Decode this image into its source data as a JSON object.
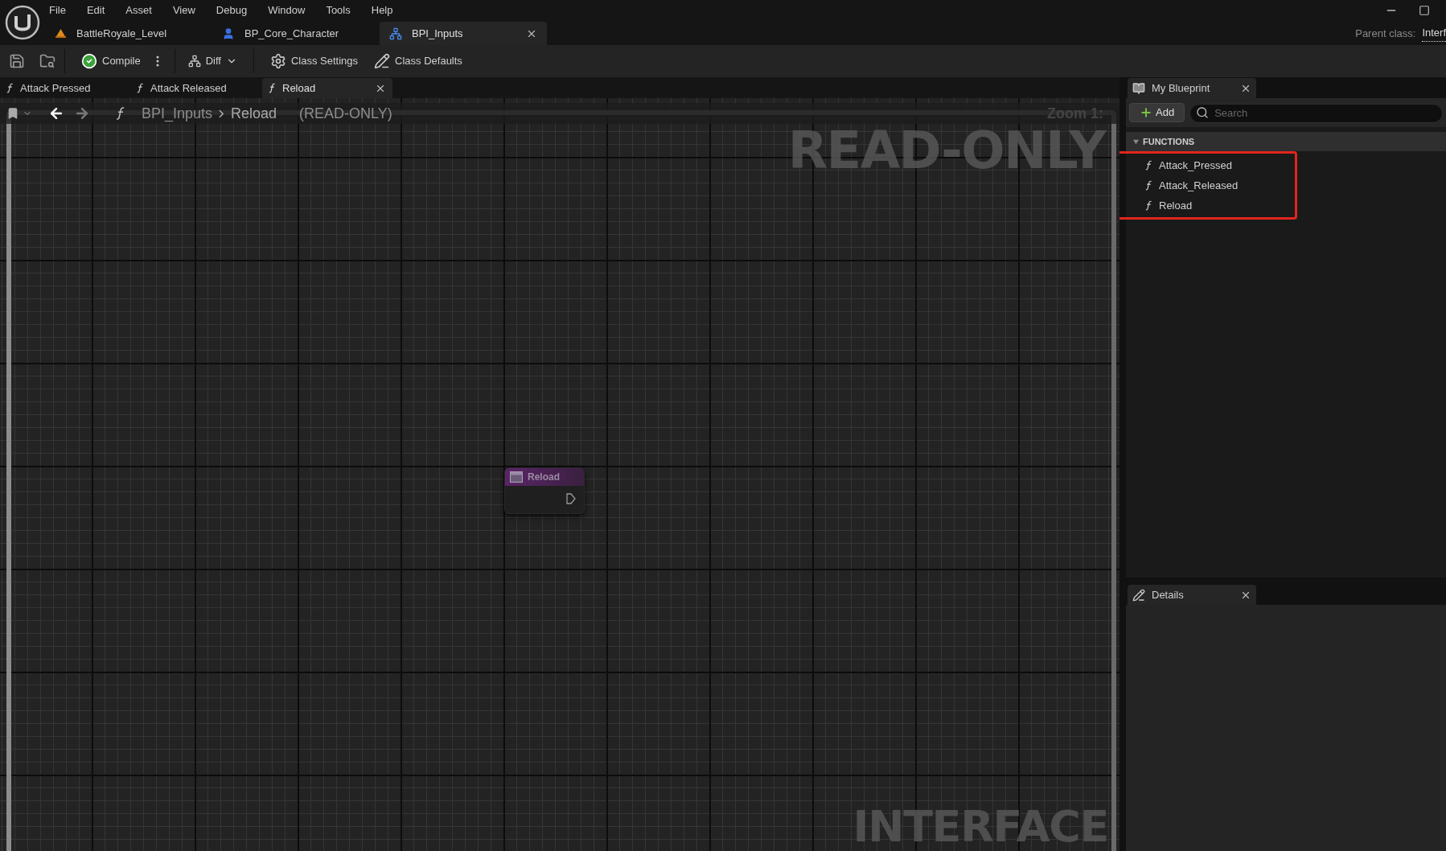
{
  "menu": [
    "File",
    "Edit",
    "Asset",
    "View",
    "Debug",
    "Window",
    "Tools",
    "Help"
  ],
  "asset_tabs": [
    {
      "label": "BattleRoyale_Level",
      "kind": "level",
      "selected": false
    },
    {
      "label": "BP_Core_Character",
      "kind": "character",
      "selected": false
    },
    {
      "label": "BPI_Inputs",
      "kind": "interface",
      "selected": true
    }
  ],
  "parent_class": {
    "label": "Parent class:",
    "value": "Interf"
  },
  "toolbar": [
    {
      "kind": "save"
    },
    {
      "kind": "browse"
    },
    {
      "kind": "compile",
      "label": "Compile"
    },
    {
      "kind": "diff",
      "label": "Diff"
    },
    {
      "kind": "class_settings",
      "label": "Class Settings"
    },
    {
      "kind": "class_defaults",
      "label": "Class Defaults"
    }
  ],
  "graph_tabs": [
    {
      "label": "Attack Pressed",
      "selected": false
    },
    {
      "label": "Attack Released",
      "selected": false
    },
    {
      "label": "Reload",
      "selected": true
    }
  ],
  "breadcrumb": {
    "path": [
      "BPI_Inputs",
      "Reload"
    ],
    "suffix": "(READ-ONLY)"
  },
  "graph": {
    "zoom": "Zoom 1:",
    "watermark": "READ-ONLY",
    "footer_watermark": "INTERFACE",
    "nodes": [
      {
        "title": "Reload"
      }
    ]
  },
  "my_blueprint": {
    "tab": "My Blueprint",
    "add": "Add",
    "search_placeholder": "Search",
    "sections": [
      {
        "title": "FUNCTIONS",
        "expanded": true,
        "highlighted": true,
        "items": [
          "Attack_Pressed",
          "Attack_Released",
          "Reload"
        ]
      }
    ]
  },
  "details": {
    "tab": "Details"
  }
}
